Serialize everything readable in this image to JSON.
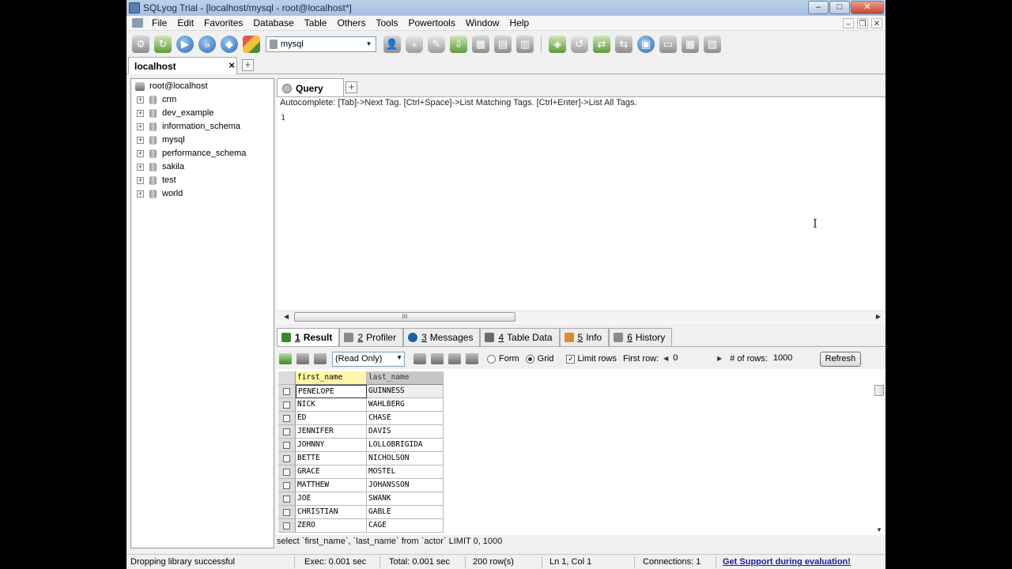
{
  "window": {
    "title": "SQLyog Trial - [localhost/mysql - root@localhost*]"
  },
  "menu": [
    "File",
    "Edit",
    "Favorites",
    "Database",
    "Table",
    "Others",
    "Tools",
    "Powertools",
    "Window",
    "Help"
  ],
  "toolbar": {
    "database_select": "mysql"
  },
  "connection_tab": {
    "label": "localhost",
    "close": "×",
    "add": "+"
  },
  "object_browser": {
    "root": "root@localhost",
    "databases": [
      "crm",
      "dev_example",
      "information_schema",
      "mysql",
      "performance_schema",
      "sakila",
      "test",
      "world"
    ]
  },
  "query": {
    "tab_label": "Query",
    "autocomplete_hint": "Autocomplete: [Tab]->Next Tag. [Ctrl+Space]->List Matching Tags. [Ctrl+Enter]->List All Tags.",
    "line_number": "1"
  },
  "result_tabs": [
    {
      "num": "1",
      "label": "Result",
      "icon": "result-icon",
      "color": "#3a8a2d"
    },
    {
      "num": "2",
      "label": "Profiler",
      "icon": "profiler-icon",
      "color": "#8a8a8a"
    },
    {
      "num": "3",
      "label": "Messages",
      "icon": "messages-icon",
      "color": "#1e5fa8"
    },
    {
      "num": "4",
      "label": "Table Data",
      "icon": "table-data-icon",
      "color": "#6b6b6b"
    },
    {
      "num": "5",
      "label": "Info",
      "icon": "info-icon",
      "color": "#e08b2a"
    },
    {
      "num": "6",
      "label": "History",
      "icon": "history-icon",
      "color": "#8a8a8a"
    }
  ],
  "result_toolbar": {
    "mode_select": "(Read Only)",
    "form_label": "Form",
    "grid_label": "Grid",
    "limit_rows_label": "Limit rows",
    "first_row_label": "First row:",
    "first_row_value": "0",
    "num_rows_label": "# of rows:",
    "num_rows_value": "1000",
    "refresh_label": "Refresh"
  },
  "grid": {
    "columns": [
      "first_name",
      "last_name"
    ],
    "rows": [
      [
        "PENELOPE",
        "GUINNESS"
      ],
      [
        "NICK",
        "WAHLBERG"
      ],
      [
        "ED",
        "CHASE"
      ],
      [
        "JENNIFER",
        "DAVIS"
      ],
      [
        "JOHNNY",
        "LOLLOBRIGIDA"
      ],
      [
        "BETTE",
        "NICHOLSON"
      ],
      [
        "GRACE",
        "MOSTEL"
      ],
      [
        "MATTHEW",
        "JOHANSSON"
      ],
      [
        "JOE",
        "SWANK"
      ],
      [
        "CHRISTIAN",
        "GABLE"
      ],
      [
        "ZERO",
        "CAGE"
      ]
    ]
  },
  "executed_sql": "select `first_name`, `last_name` from `actor` LIMIT 0, 1000",
  "status": {
    "message": "Dropping library successful",
    "exec": "Exec: 0.001 sec",
    "total": "Total: 0.001 sec",
    "rows": "200 row(s)",
    "position": "Ln 1, Col 1",
    "connections": "Connections: 1",
    "support": "Get Support during evaluation!"
  }
}
